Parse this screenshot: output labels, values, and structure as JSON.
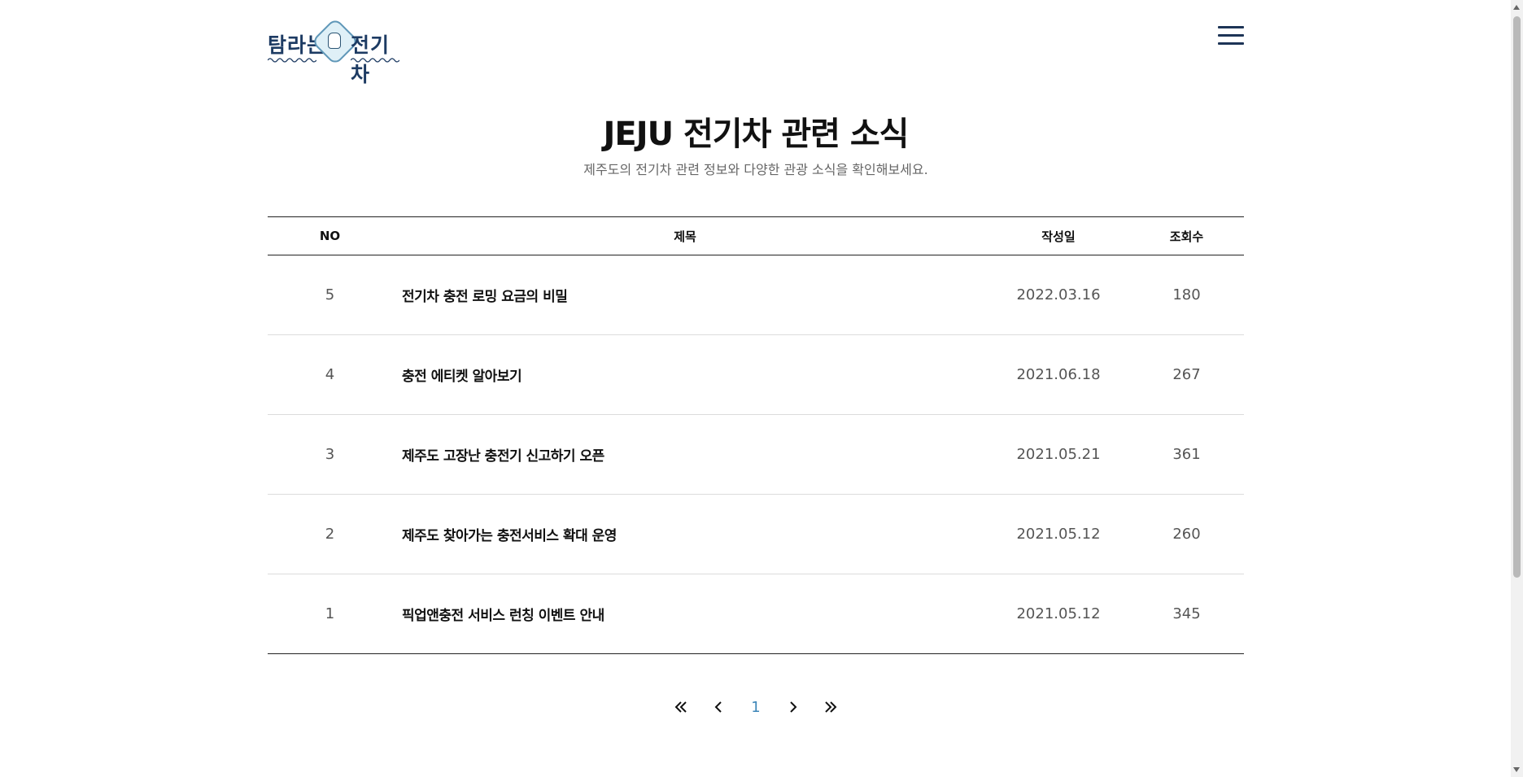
{
  "header": {
    "logo_left": "탐라는",
    "logo_right": "전기차",
    "menu_icon": "hamburger-menu-icon"
  },
  "main": {
    "title": "JEJU 전기차 관련 소식",
    "subtitle": "제주도의 전기차 관련 정보와 다양한 관광 소식을 확인해보세요."
  },
  "table": {
    "columns": {
      "no": "NO",
      "title": "제목",
      "date": "작성일",
      "views": "조회수"
    },
    "rows": [
      {
        "no": "5",
        "title": "전기차 충전 로밍 요금의 비밀",
        "date": "2022.03.16",
        "views": "180"
      },
      {
        "no": "4",
        "title": "충전 에티켓 알아보기",
        "date": "2021.06.18",
        "views": "267"
      },
      {
        "no": "3",
        "title": "제주도 고장난 충전기 신고하기 오픈",
        "date": "2021.05.21",
        "views": "361"
      },
      {
        "no": "2",
        "title": "제주도 찾아가는 충전서비스 확대 운영",
        "date": "2021.05.12",
        "views": "260"
      },
      {
        "no": "1",
        "title": "픽업앤충전 서비스 런칭 이벤트 안내",
        "date": "2021.05.12",
        "views": "345"
      }
    ]
  },
  "pagination": {
    "current_page": "1",
    "icons": [
      "double-chevron-left-icon",
      "chevron-left-icon",
      "chevron-right-icon",
      "double-chevron-right-icon"
    ]
  },
  "colors": {
    "logo": "#1d3b63",
    "menu": "#1d3456",
    "active_page": "#3d86b8",
    "badge_fill": "#dff0f7",
    "badge_stroke": "#5f97b8"
  }
}
